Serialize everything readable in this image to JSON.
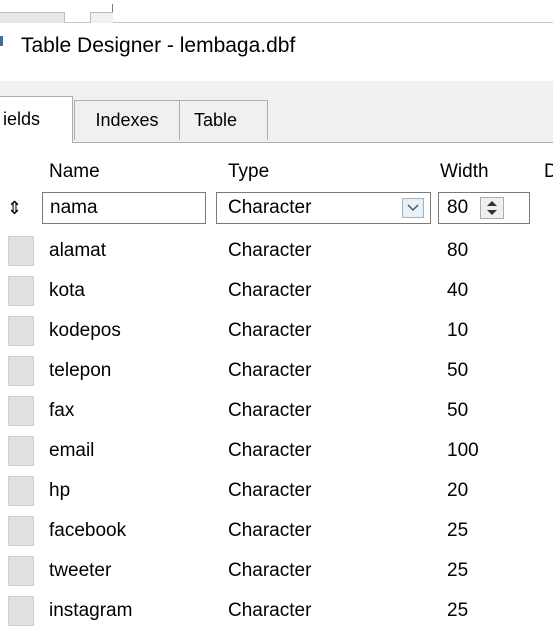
{
  "window": {
    "title": "Table Designer - lembaga.dbf"
  },
  "tabs": [
    {
      "label": "ields",
      "active": true
    },
    {
      "label": "Indexes",
      "active": false
    },
    {
      "label": "Table",
      "active": false
    }
  ],
  "columns": {
    "name": "Name",
    "type": "Type",
    "width": "Width",
    "decimal": "D"
  },
  "fields": [
    {
      "name": "nama",
      "type": "Character",
      "width": "80"
    },
    {
      "name": "alamat",
      "type": "Character",
      "width": "80"
    },
    {
      "name": "kota",
      "type": "Character",
      "width": "40"
    },
    {
      "name": "kodepos",
      "type": "Character",
      "width": "10"
    },
    {
      "name": "telepon",
      "type": "Character",
      "width": "50"
    },
    {
      "name": "fax",
      "type": "Character",
      "width": "50"
    },
    {
      "name": "email",
      "type": "Character",
      "width": "100"
    },
    {
      "name": "hp",
      "type": "Character",
      "width": "20"
    },
    {
      "name": "facebook",
      "type": "Character",
      "width": "25"
    },
    {
      "name": "tweeter",
      "type": "Character",
      "width": "25"
    },
    {
      "name": "instagram",
      "type": "Character",
      "width": "25"
    }
  ],
  "selected_row_indicator": "⇕",
  "icons": {
    "row_selector": "row-move-icon",
    "type_dropdown": "chevron-down-icon",
    "width_spinner": "spinner-icon"
  },
  "colors": {
    "dialog_bg": "#f0f0f0",
    "grid_bg": "#ffffff",
    "border": "#adadad",
    "dropdown_button": "#e5f1fb"
  }
}
